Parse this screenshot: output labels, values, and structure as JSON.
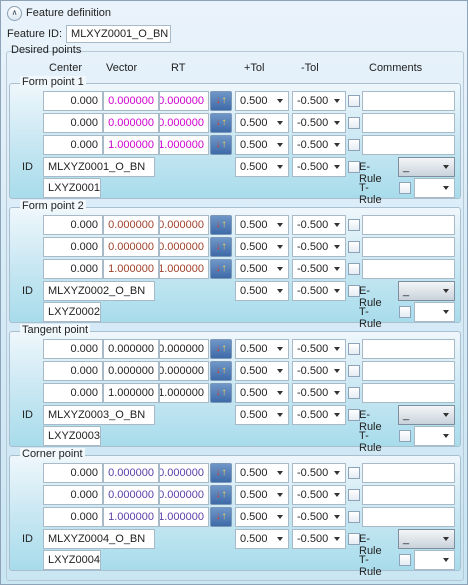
{
  "header": {
    "title": "Feature definition",
    "feature_id_label": "Feature ID:",
    "feature_id_value": "MLXYZ0001_O_BN"
  },
  "desired_points_label": "Desired points",
  "columns": {
    "center": "Center",
    "vector": "Vector",
    "rt": "RT",
    "plus_tol": "+Tol",
    "minus_tol": "-Tol",
    "comments": "Comments"
  },
  "id_label": "ID",
  "e_rule_label": "E-Rule",
  "t_rule_label": "T-Rule",
  "e_rule_value": "_",
  "colors": {
    "magenta": "#d000d0",
    "brown": "#a0402a",
    "dark": "#222222",
    "purple": "#5a3ea8"
  },
  "groups": [
    {
      "title": "Form point 1",
      "rows": [
        {
          "center": "0.000",
          "vector": "0.000000",
          "rt": "0.000000",
          "plus_tol": "0.500",
          "minus_tol": "-0.500",
          "comment": ""
        },
        {
          "center": "0.000",
          "vector": "0.000000",
          "rt": "0.000000",
          "plus_tol": "0.500",
          "minus_tol": "-0.500",
          "comment": ""
        },
        {
          "center": "0.000",
          "vector": "1.000000",
          "rt": "1.000000",
          "plus_tol": "0.500",
          "minus_tol": "-0.500",
          "comment": ""
        }
      ],
      "id_value": "MLXYZ0001_O_BN",
      "sub_id": "LXYZ0001",
      "plus_tol": "0.500",
      "minus_tol": "-0.500"
    },
    {
      "title": "Form point 2",
      "rows": [
        {
          "center": "0.000",
          "vector": "0.000000",
          "rt": "0.000000",
          "plus_tol": "0.500",
          "minus_tol": "-0.500",
          "comment": ""
        },
        {
          "center": "0.000",
          "vector": "0.000000",
          "rt": "0.000000",
          "plus_tol": "0.500",
          "minus_tol": "-0.500",
          "comment": ""
        },
        {
          "center": "0.000",
          "vector": "1.000000",
          "rt": "1.000000",
          "plus_tol": "0.500",
          "minus_tol": "-0.500",
          "comment": ""
        }
      ],
      "id_value": "MLXYZ0002_O_BN",
      "sub_id": "LXYZ0002",
      "plus_tol": "0.500",
      "minus_tol": "-0.500"
    },
    {
      "title": "Tangent point",
      "rows": [
        {
          "center": "0.000",
          "vector": "0.000000",
          "rt": "0.000000",
          "plus_tol": "0.500",
          "minus_tol": "-0.500",
          "comment": ""
        },
        {
          "center": "0.000",
          "vector": "0.000000",
          "rt": "0.000000",
          "plus_tol": "0.500",
          "minus_tol": "-0.500",
          "comment": ""
        },
        {
          "center": "0.000",
          "vector": "1.000000",
          "rt": "1.000000",
          "plus_tol": "0.500",
          "minus_tol": "-0.500",
          "comment": ""
        }
      ],
      "id_value": "MLXYZ0003_O_BN",
      "sub_id": "LXYZ0003",
      "plus_tol": "0.500",
      "minus_tol": "-0.500"
    },
    {
      "title": "Corner point",
      "rows": [
        {
          "center": "0.000",
          "vector": "0.000000",
          "rt": "0.000000",
          "plus_tol": "0.500",
          "minus_tol": "-0.500",
          "comment": ""
        },
        {
          "center": "0.000",
          "vector": "0.000000",
          "rt": "0.000000",
          "plus_tol": "0.500",
          "minus_tol": "-0.500",
          "comment": ""
        },
        {
          "center": "0.000",
          "vector": "1.000000",
          "rt": "1.000000",
          "plus_tol": "0.500",
          "minus_tol": "-0.500",
          "comment": ""
        }
      ],
      "id_value": "MLXYZ0004_O_BN",
      "sub_id": "LXYZ0004",
      "plus_tol": "0.500",
      "minus_tol": "-0.500"
    }
  ]
}
